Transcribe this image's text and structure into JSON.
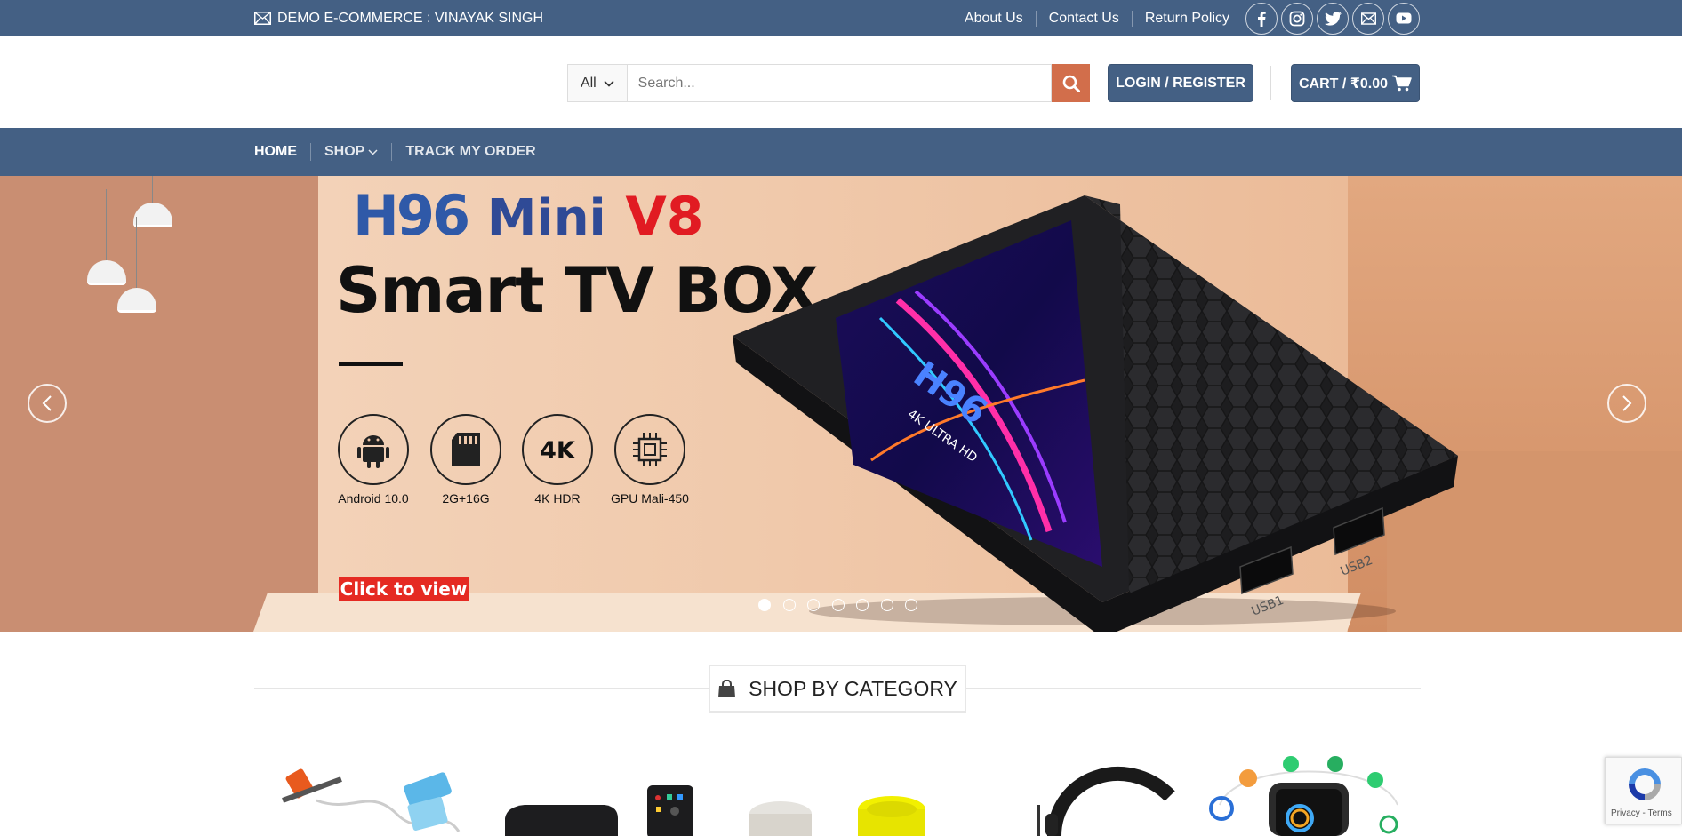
{
  "topbar": {
    "contact_label": "DEMO E-COMMERCE : VINAYAK SINGH",
    "links": [
      "About Us",
      "Contact Us",
      "Return Policy"
    ],
    "social_icons": [
      "facebook-icon",
      "instagram-icon",
      "twitter-icon",
      "email-icon",
      "youtube-icon"
    ]
  },
  "header": {
    "category_select": "All",
    "search_placeholder": "Search...",
    "login_label": "LOGIN / REGISTER",
    "cart_label": "CART / ₹0.00"
  },
  "nav": {
    "items": [
      "HOME",
      "SHOP",
      "TRACK MY ORDER"
    ]
  },
  "hero": {
    "brand_h96": "H96",
    "brand_mini": "Mini",
    "brand_v8": "V8",
    "headline": "Smart TV BOX",
    "features": [
      "Android 10.0",
      "2G+16G",
      "4K HDR",
      "GPU Mali-450"
    ],
    "cta": "Click to view",
    "slide_count": 7,
    "active_slide": 1
  },
  "section": {
    "title": "SHOP BY CATEGORY"
  },
  "recaptcha": {
    "text": "Privacy - Terms"
  },
  "colors": {
    "primary": "#446084",
    "accent": "#d26e4b",
    "cta_red": "#e52a22"
  }
}
